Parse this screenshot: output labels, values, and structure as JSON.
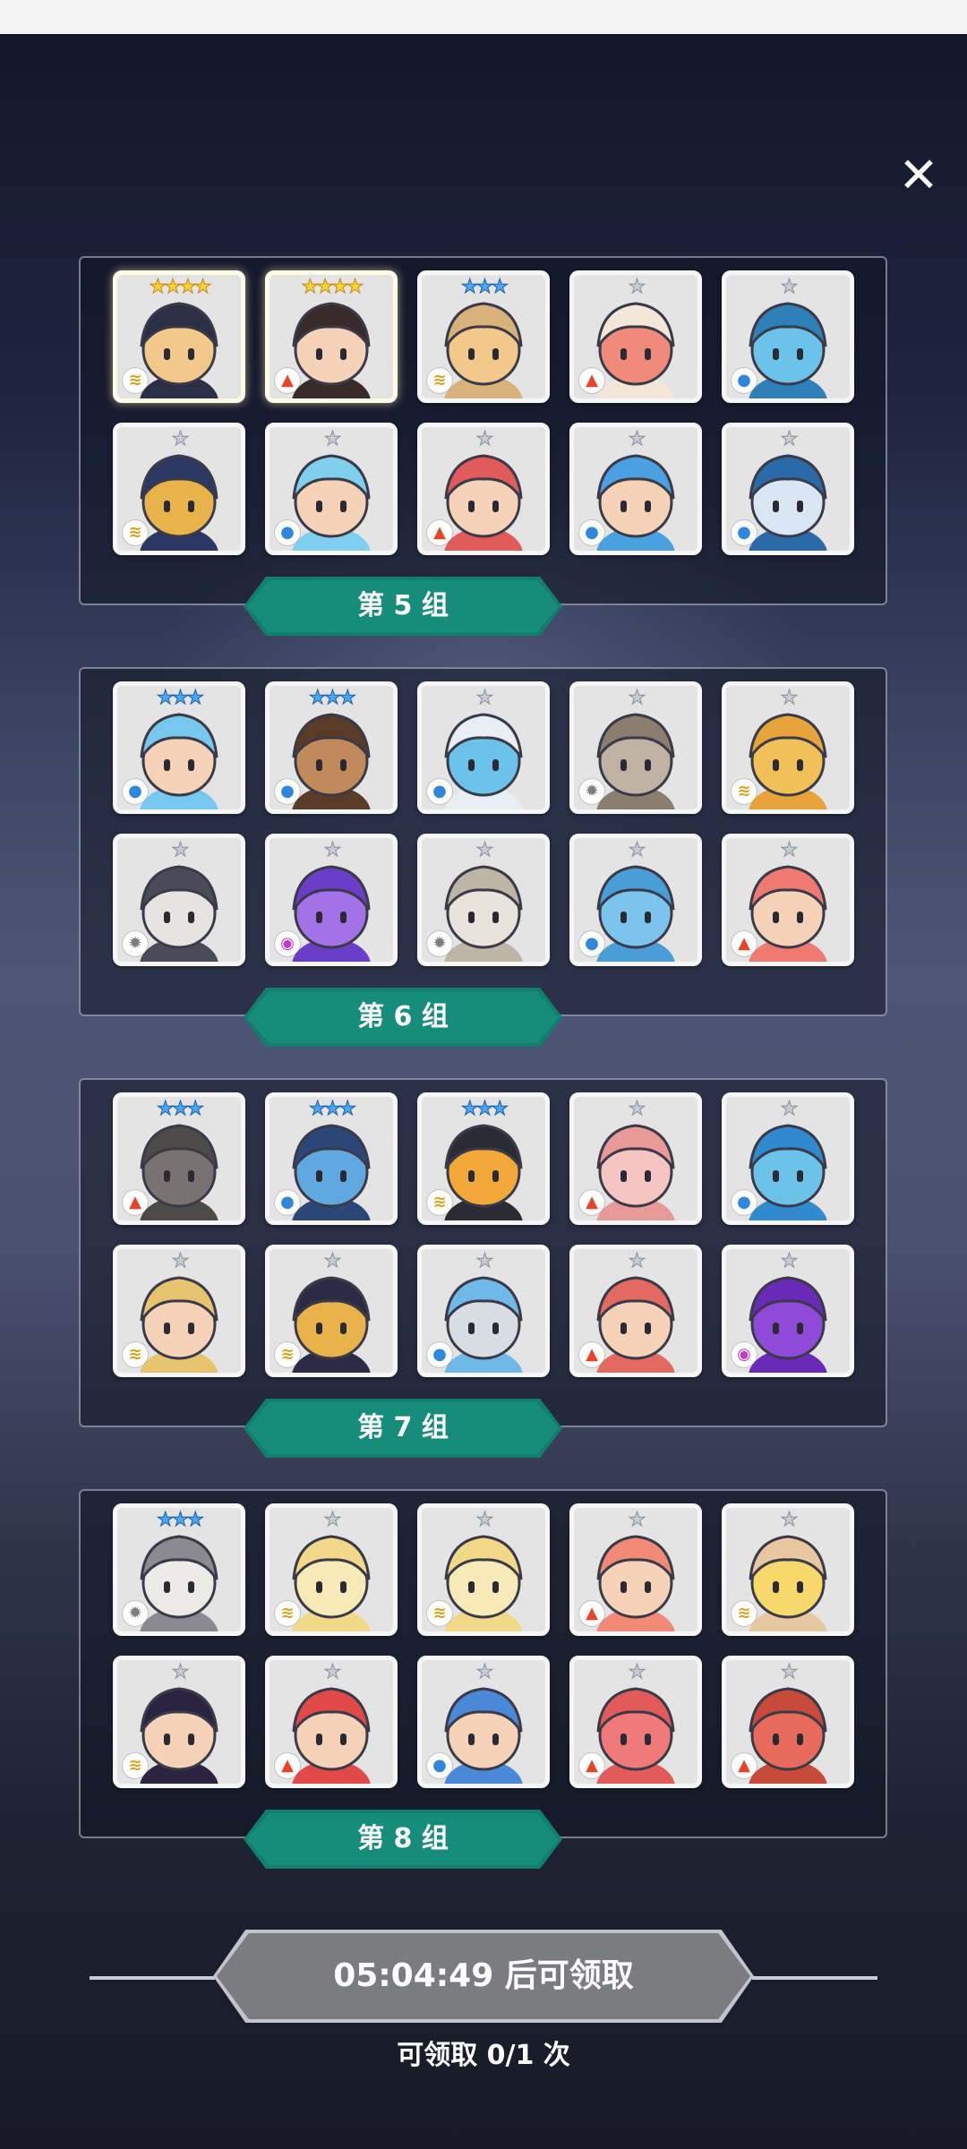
{
  "close_label": "✕",
  "groups": [
    {
      "label": "第 5 组",
      "heroes": [
        {
          "name": "hero-1",
          "stars": 4,
          "star_color": "gold",
          "element": "wind",
          "skin": "#f2c98a",
          "hair": "#2a2f45"
        },
        {
          "name": "hero-2",
          "stars": 4,
          "star_color": "gold",
          "element": "fire",
          "skin": "#f6d2b8",
          "hair": "#3a2b2b"
        },
        {
          "name": "hero-3",
          "stars": 3,
          "star_color": "blue",
          "element": "wind",
          "skin": "#f2c98a",
          "hair": "#d8b27a"
        },
        {
          "name": "hero-4",
          "stars": 1,
          "star_color": "silver",
          "element": "fire",
          "skin": "#f08a7a",
          "hair": "#f4e6d8"
        },
        {
          "name": "hero-5",
          "stars": 1,
          "star_color": "silver",
          "element": "water",
          "skin": "#6cc3ea",
          "hair": "#2f7fb8"
        },
        {
          "name": "hero-6",
          "stars": 1,
          "star_color": "silver",
          "element": "wind",
          "skin": "#e9b24a",
          "hair": "#2c3763"
        },
        {
          "name": "hero-7",
          "stars": 1,
          "star_color": "silver",
          "element": "water",
          "skin": "#f6d2b8",
          "hair": "#7fd0ee"
        },
        {
          "name": "hero-8",
          "stars": 1,
          "star_color": "silver",
          "element": "fire",
          "skin": "#f6d2b8",
          "hair": "#e25b5b"
        },
        {
          "name": "hero-9",
          "stars": 1,
          "star_color": "silver",
          "element": "water",
          "skin": "#f6d2b8",
          "hair": "#4aa0e0"
        },
        {
          "name": "hero-10",
          "stars": 1,
          "star_color": "silver",
          "element": "water",
          "skin": "#d9e7f5",
          "hair": "#2b6aa8"
        }
      ]
    },
    {
      "label": "第 6 组",
      "heroes": [
        {
          "name": "hero-11",
          "stars": 3,
          "star_color": "blue",
          "element": "water",
          "skin": "#f6d2b8",
          "hair": "#76c8ee"
        },
        {
          "name": "hero-12",
          "stars": 3,
          "star_color": "blue",
          "element": "water",
          "skin": "#c08a5a",
          "hair": "#5a3b28"
        },
        {
          "name": "hero-13",
          "stars": 1,
          "star_color": "silver",
          "element": "water",
          "skin": "#6cc3ea",
          "hair": "#e8eef4"
        },
        {
          "name": "hero-14",
          "stars": 1,
          "star_color": "silver",
          "element": "light",
          "skin": "#bfb2a2",
          "hair": "#8c7e6e"
        },
        {
          "name": "hero-15",
          "stars": 1,
          "star_color": "silver",
          "element": "wind",
          "skin": "#f2c058",
          "hair": "#e6a43a"
        },
        {
          "name": "hero-16",
          "stars": 1,
          "star_color": "silver",
          "element": "light",
          "skin": "#e6e3e0",
          "hair": "#4a4a58"
        },
        {
          "name": "hero-17",
          "stars": 1,
          "star_color": "silver",
          "element": "dark",
          "skin": "#a372e8",
          "hair": "#6b3ec8"
        },
        {
          "name": "hero-18",
          "stars": 1,
          "star_color": "silver",
          "element": "light",
          "skin": "#e8e4dc",
          "hair": "#bdb5a6"
        },
        {
          "name": "hero-19",
          "stars": 1,
          "star_color": "silver",
          "element": "water",
          "skin": "#7cc4ee",
          "hair": "#4a9ed8"
        },
        {
          "name": "hero-20",
          "stars": 1,
          "star_color": "silver",
          "element": "fire",
          "skin": "#f6d2b8",
          "hair": "#f07a72"
        }
      ]
    },
    {
      "label": "第 7 组",
      "heroes": [
        {
          "name": "hero-21",
          "stars": 3,
          "star_color": "blue",
          "element": "fire",
          "skin": "#7a7272",
          "hair": "#4d4a4a"
        },
        {
          "name": "hero-22",
          "stars": 3,
          "star_color": "blue",
          "element": "water",
          "skin": "#5fa8e0",
          "hair": "#2b4678"
        },
        {
          "name": "hero-23",
          "stars": 3,
          "star_color": "blue",
          "element": "wind",
          "skin": "#f2a838",
          "hair": "#2b2b35"
        },
        {
          "name": "hero-24",
          "stars": 1,
          "star_color": "silver",
          "element": "fire",
          "skin": "#f6c4c2",
          "hair": "#e89a98"
        },
        {
          "name": "hero-25",
          "stars": 1,
          "star_color": "silver",
          "element": "water",
          "skin": "#6cc3ea",
          "hair": "#2f8ad0"
        },
        {
          "name": "hero-26",
          "stars": 1,
          "star_color": "silver",
          "element": "wind",
          "skin": "#f6d2b8",
          "hair": "#e8c470"
        },
        {
          "name": "hero-27",
          "stars": 1,
          "star_color": "silver",
          "element": "wind",
          "skin": "#e9b24a",
          "hair": "#2b2b45"
        },
        {
          "name": "hero-28",
          "stars": 1,
          "star_color": "silver",
          "element": "water",
          "skin": "#d8dde3",
          "hair": "#6fb8e8"
        },
        {
          "name": "hero-29",
          "stars": 1,
          "star_color": "silver",
          "element": "fire",
          "skin": "#f6d2b8",
          "hair": "#e26a60"
        },
        {
          "name": "hero-30",
          "stars": 1,
          "star_color": "silver",
          "element": "dark",
          "skin": "#8f4ad8",
          "hair": "#6a2ab8"
        }
      ]
    },
    {
      "label": "第 8 组",
      "heroes": [
        {
          "name": "hero-31",
          "stars": 3,
          "star_color": "blue",
          "element": "light",
          "skin": "#ecebe8",
          "hair": "#8a8a90"
        },
        {
          "name": "hero-32",
          "stars": 1,
          "star_color": "silver",
          "element": "wind",
          "skin": "#f8eab8",
          "hair": "#f2d98a"
        },
        {
          "name": "hero-33",
          "stars": 1,
          "star_color": "silver",
          "element": "wind",
          "skin": "#f8eab8",
          "hair": "#f2d98a"
        },
        {
          "name": "hero-34",
          "stars": 1,
          "star_color": "silver",
          "element": "fire",
          "skin": "#f6d2b8",
          "hair": "#f28a78"
        },
        {
          "name": "hero-35",
          "stars": 1,
          "star_color": "silver",
          "element": "wind",
          "skin": "#f7d86a",
          "hair": "#e8c8a0"
        },
        {
          "name": "hero-36",
          "stars": 1,
          "star_color": "silver",
          "element": "wind",
          "skin": "#f6d2b8",
          "hair": "#2b2440"
        },
        {
          "name": "hero-37",
          "stars": 1,
          "star_color": "silver",
          "element": "fire",
          "skin": "#f6d2b8",
          "hair": "#e24a4a"
        },
        {
          "name": "hero-38",
          "stars": 1,
          "star_color": "silver",
          "element": "water",
          "skin": "#f6d2b8",
          "hair": "#4a88d8"
        },
        {
          "name": "hero-39",
          "stars": 1,
          "star_color": "silver",
          "element": "fire",
          "skin": "#f07a7a",
          "hair": "#e25a5a"
        },
        {
          "name": "hero-40",
          "stars": 1,
          "star_color": "silver",
          "element": "fire",
          "skin": "#e86a5a",
          "hair": "#c84a3a"
        }
      ]
    }
  ],
  "timer_text": "05:04:49 后可领取",
  "claim_text": "可领取 0/1 次",
  "colors": {
    "banner": "#168d7a",
    "timer_button": "#7a7c80",
    "element_water": "#2f86dd",
    "element_fire": "#e8442a",
    "element_wind": "#e0a018",
    "element_light": "#7d7d7d",
    "element_dark": "#c23ac8"
  },
  "icons": {
    "water": "water-drop-icon",
    "fire": "flame-icon",
    "wind": "tornado-icon",
    "light": "sun-gear-icon",
    "dark": "dark-swirl-icon"
  }
}
